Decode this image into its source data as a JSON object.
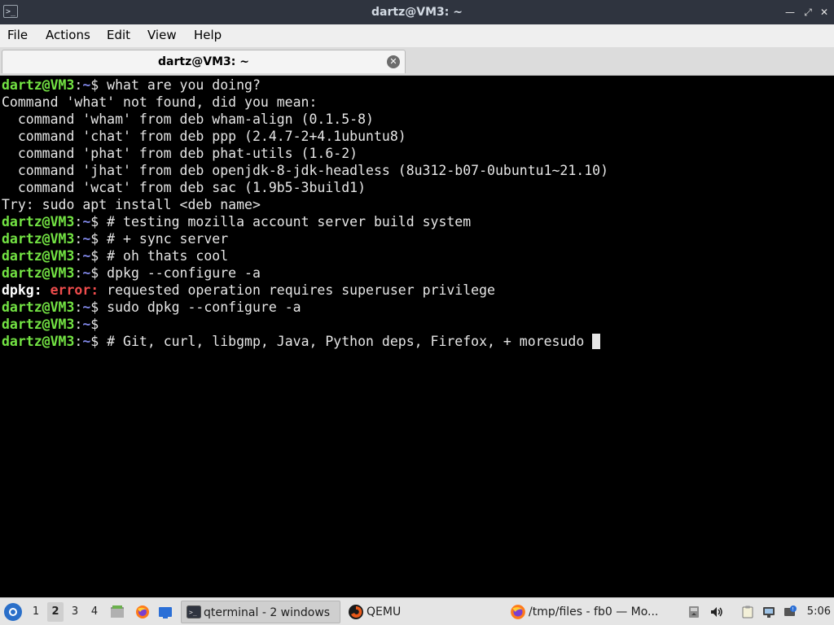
{
  "window": {
    "title": "dartz@VM3: ~",
    "controls": [
      "minimize-icon",
      "maximize-icon",
      "close-icon"
    ]
  },
  "menubar": {
    "items": [
      "File",
      "Actions",
      "Edit",
      "View",
      "Help"
    ]
  },
  "tabs": [
    {
      "label": "dartz@VM3: ~",
      "close_icon": "close-circle-icon"
    }
  ],
  "terminal": {
    "prompt": {
      "user": "dartz@VM3",
      "sep": ":",
      "path": "~",
      "symbol": "$ "
    },
    "lines": [
      {
        "type": "prompt",
        "cmd": "what are you doing?"
      },
      {
        "type": "text",
        "text": "Command 'what' not found, did you mean:"
      },
      {
        "type": "text",
        "text": "  command 'wham' from deb wham-align (0.1.5-8)"
      },
      {
        "type": "text",
        "text": "  command 'chat' from deb ppp (2.4.7-2+4.1ubuntu8)"
      },
      {
        "type": "text",
        "text": "  command 'phat' from deb phat-utils (1.6-2)"
      },
      {
        "type": "text",
        "text": "  command 'jhat' from deb openjdk-8-jdk-headless (8u312-b07-0ubuntu1~21.10)"
      },
      {
        "type": "text",
        "text": "  command 'wcat' from deb sac (1.9b5-3build1)"
      },
      {
        "type": "text",
        "text": "Try: sudo apt install <deb name>"
      },
      {
        "type": "prompt",
        "cmd": "# testing mozilla account server build system"
      },
      {
        "type": "prompt",
        "cmd": "# + sync server"
      },
      {
        "type": "prompt",
        "cmd": "# oh thats cool"
      },
      {
        "type": "prompt",
        "cmd": "dpkg --configure -a"
      },
      {
        "type": "error",
        "prog": "dpkg:",
        "label": "error:",
        "msg": "requested operation requires superuser privilege"
      },
      {
        "type": "prompt",
        "cmd": "sudo dpkg --configure -a"
      },
      {
        "type": "prompt",
        "cmd": ""
      },
      {
        "type": "prompt",
        "cmd": "# Git, curl, libgmp, Java, Python deps, Firefox, + moresudo ",
        "cursor": true
      }
    ],
    "colors": {
      "user": "#73e343",
      "path": "#7f86e6",
      "error": "#ef4c4c",
      "text": "#e6e6e6"
    }
  },
  "taskbar": {
    "menu_icon": "start-menu-icon",
    "workspaces": [
      "1",
      "2",
      "3",
      "4"
    ],
    "active_workspace": "2",
    "quicklaunch": [
      "file-manager-icon",
      "firefox-icon",
      "show-desktop-icon"
    ],
    "tasks": [
      {
        "label": "qterminal - 2 windows",
        "icon": "terminal-icon",
        "active": true
      },
      {
        "label": "QEMU",
        "icon": "qemu-icon",
        "active": false
      },
      {
        "label": "/tmp/files - fb0 — Mo...",
        "icon": "firefox-icon",
        "active": false
      }
    ],
    "tray": [
      "disk-icon",
      "volume-icon",
      "clipboard-icon",
      "network-icon",
      "update-icon"
    ],
    "clock": "5:06"
  }
}
